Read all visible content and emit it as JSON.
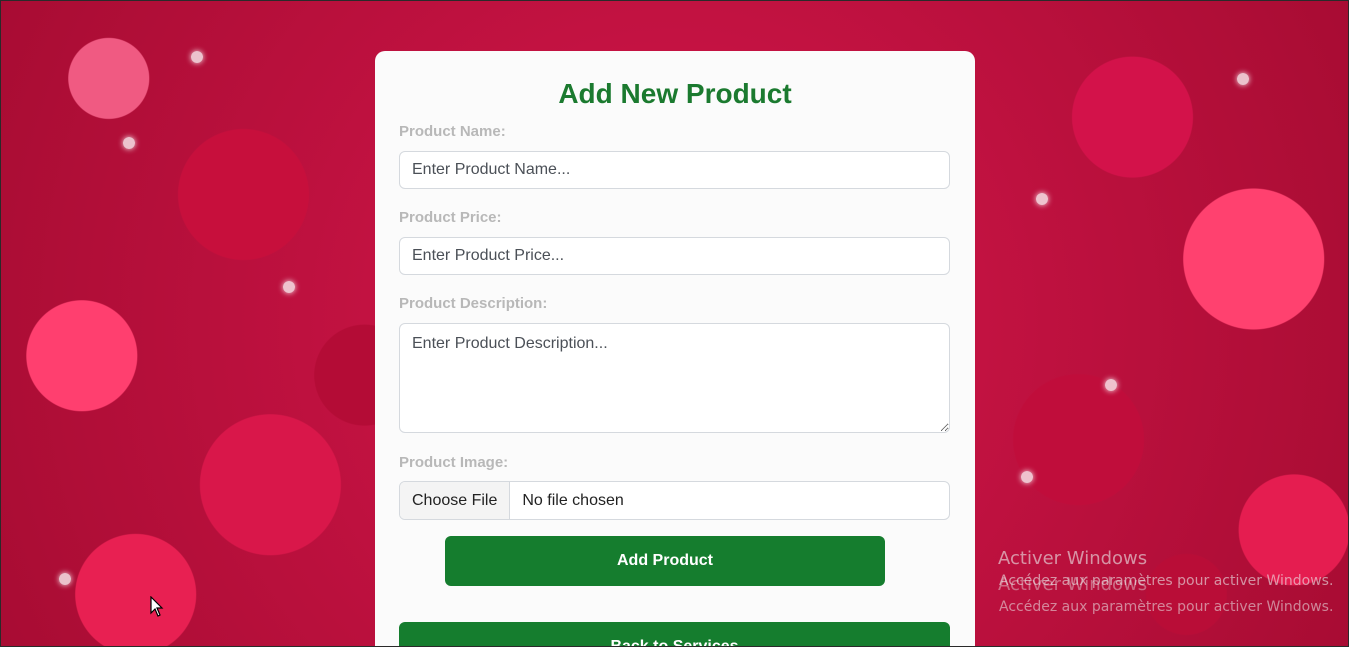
{
  "form": {
    "title": "Add New Product",
    "product_name": {
      "label": "Product Name:",
      "placeholder": "Enter Product Name..."
    },
    "product_price": {
      "label": "Product Price:",
      "placeholder": "Enter Product Price..."
    },
    "product_description": {
      "label": "Product Description:",
      "placeholder": "Enter Product Description..."
    },
    "product_image": {
      "label": "Product Image:",
      "button_label": "Choose File",
      "status": "No file chosen"
    },
    "add_button_label": "Add Product",
    "back_button_label": "Back to Services"
  },
  "watermark": {
    "title": "Activer Windows",
    "subtitle": "Accédez aux paramètres pour activer Windows."
  },
  "colors": {
    "accent_green": "#157d2e",
    "title_green": "#1b7a2f",
    "label_gray": "#b8b8b8"
  }
}
